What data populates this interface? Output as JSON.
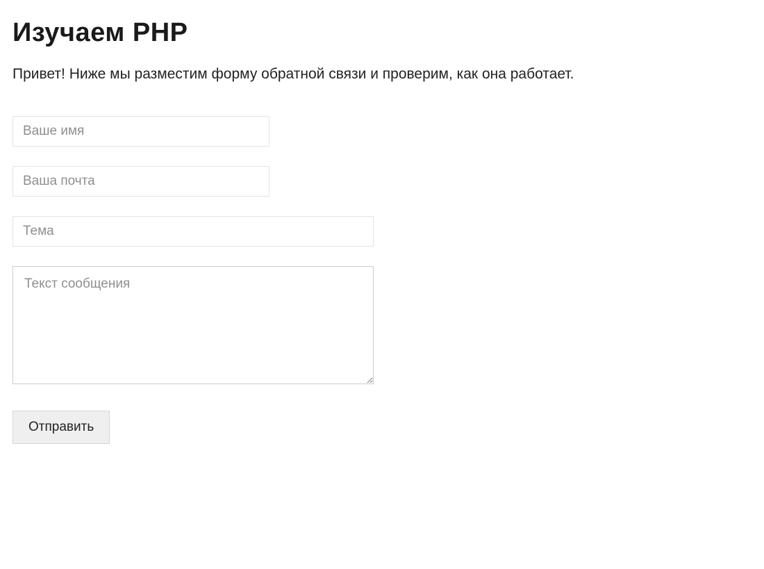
{
  "heading": "Изучаем PHP",
  "intro": "Привет! Ниже мы разместим форму обратной связи и проверим, как она работает.",
  "form": {
    "name": {
      "placeholder": "Ваше имя",
      "value": ""
    },
    "email": {
      "placeholder": "Ваша почта",
      "value": ""
    },
    "subject": {
      "placeholder": "Тема",
      "value": ""
    },
    "message": {
      "placeholder": "Текст сообщения",
      "value": ""
    },
    "submit_label": "Отправить"
  }
}
